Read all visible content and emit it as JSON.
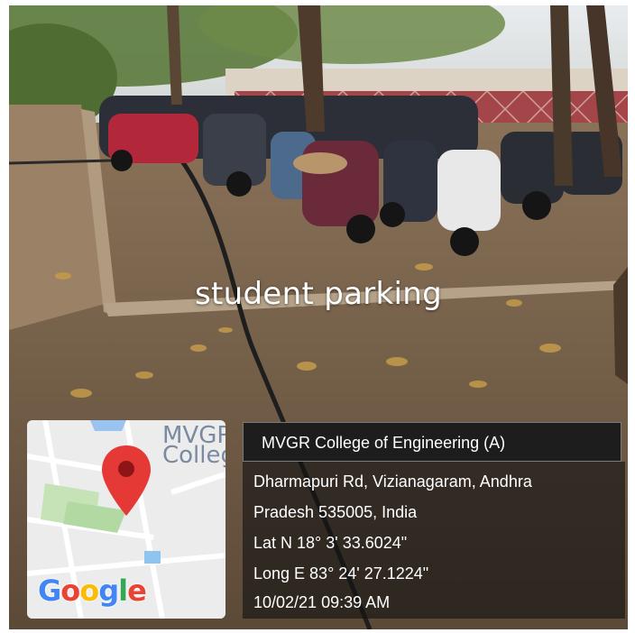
{
  "caption": "student parking",
  "map": {
    "place_label": "MVGR\nColleg",
    "brand": "Google",
    "brand_colors": [
      "#4285F4",
      "#EA4335",
      "#FBBC05",
      "#4285F4",
      "#34A853",
      "#EA4335"
    ],
    "pin_color": "#E53935"
  },
  "location": {
    "name": "MVGR College of Engineering (A)",
    "address_line1": "Dharmapuri Rd, Vizianagaram, Andhra",
    "address_line2": "Pradesh 535005, India",
    "lat": "Lat N 18° 3' 33.6024\"",
    "long": "Long E 83° 24' 27.1224\"",
    "timestamp": "10/02/21 09:39 AM"
  }
}
